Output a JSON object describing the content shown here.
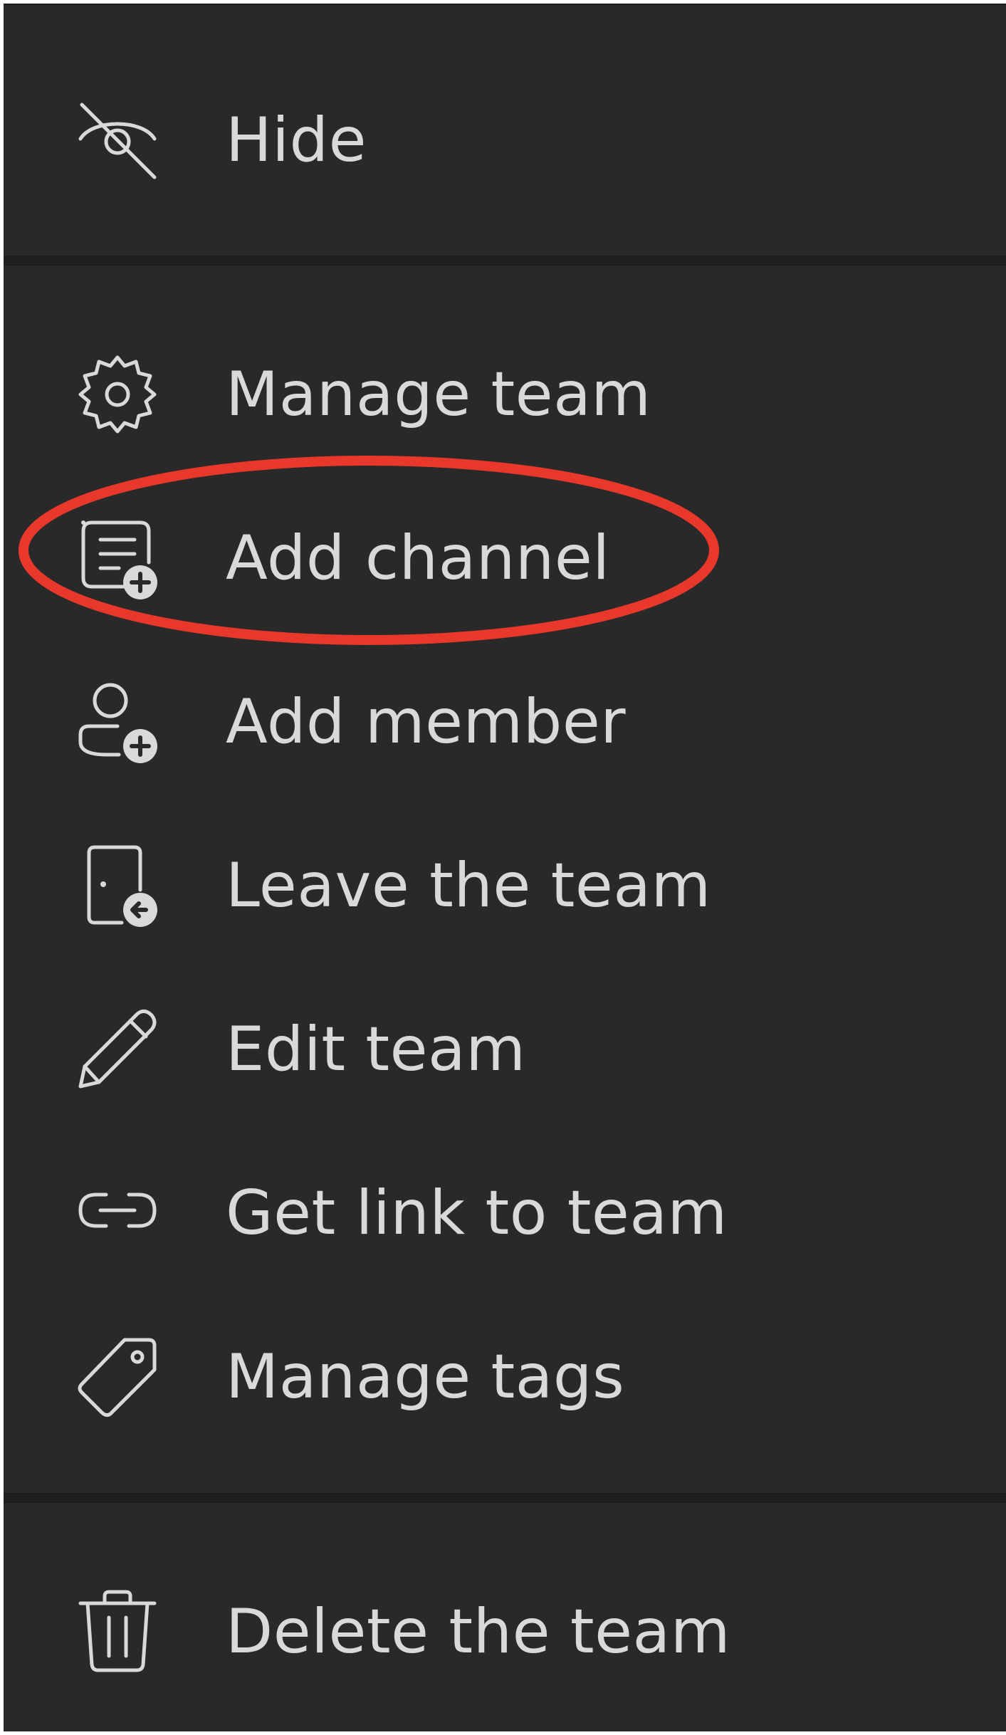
{
  "menu": {
    "items": [
      {
        "label": "Hide",
        "icon": "eye-off-icon"
      },
      {
        "label": "Manage team",
        "icon": "gear-icon"
      },
      {
        "label": "Add channel",
        "icon": "add-channel-icon"
      },
      {
        "label": "Add member",
        "icon": "add-member-icon"
      },
      {
        "label": "Leave the team",
        "icon": "leave-icon"
      },
      {
        "label": "Edit team",
        "icon": "pencil-icon"
      },
      {
        "label": "Get link to team",
        "icon": "link-icon"
      },
      {
        "label": "Manage tags",
        "icon": "tag-icon"
      },
      {
        "label": "Delete the team",
        "icon": "trash-icon"
      }
    ],
    "highlighted_item": "Add channel",
    "colors": {
      "background": "#292929",
      "text": "#d9d9d9",
      "divider": "#1f1f1f",
      "highlight_ring": "#e8372b"
    }
  }
}
